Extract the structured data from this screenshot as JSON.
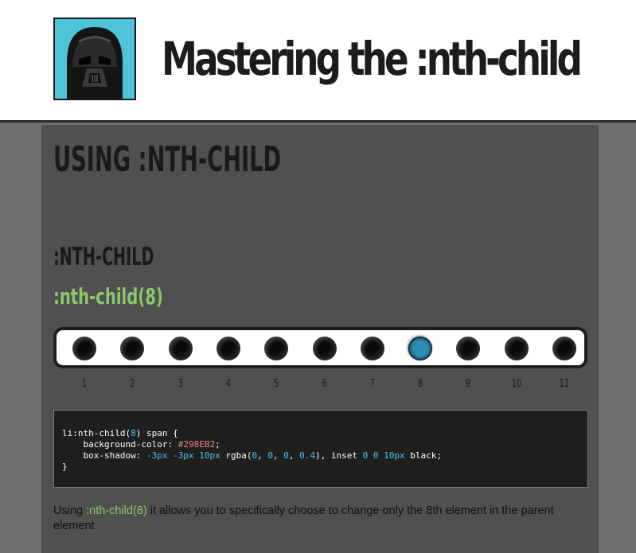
{
  "header": {
    "title": "Mastering the :nth-child",
    "avatar_icon": "darth-vader-avatar",
    "avatar_bg": "#4ec5d6"
  },
  "page": {
    "heading": "USING :NTH-CHILD",
    "subheading": ":NTH-CHILD",
    "selector": ":nth-child(8)"
  },
  "demo": {
    "items": [
      {
        "label": "1",
        "highlight": false
      },
      {
        "label": "2",
        "highlight": false
      },
      {
        "label": "3",
        "highlight": false
      },
      {
        "label": "4",
        "highlight": false
      },
      {
        "label": "5",
        "highlight": false
      },
      {
        "label": "6",
        "highlight": false
      },
      {
        "label": "7",
        "highlight": false
      },
      {
        "label": "8",
        "highlight": true
      },
      {
        "label": "9",
        "highlight": false
      },
      {
        "label": "10",
        "highlight": false
      },
      {
        "label": "11",
        "highlight": false
      }
    ],
    "highlight_color": "#298EB2"
  },
  "code": {
    "line1_selector": "li:nth-child(",
    "line1_num": "8",
    "line1_end": ") span {",
    "line2_prop": "    background-color: ",
    "line2_value": "#298EB2",
    "line2_end": ";",
    "line3_prop": "    box-shadow: ",
    "line3_a": "-3px",
    "line3_b": "-3px",
    "line3_c": "10px",
    "line3_rgba_start": " rgba(",
    "line3_r": "0",
    "line3_g": "0",
    "line3_bl": "0",
    "line3_alpha": "0.4",
    "line3_mid": "), inset ",
    "line3_d": "0",
    "line3_e": "0",
    "line3_f": "10px",
    "line3_end": " black;",
    "line4": "}"
  },
  "description": {
    "before": "Using ",
    "highlight": ":nth-child(8)",
    "after": " it allows you to specifically choose to change only the 8th element in the parent element"
  },
  "colors": {
    "accent_green": "#8cc76a",
    "code_number": "#4fc1e9",
    "code_hex": "#e8837a"
  }
}
